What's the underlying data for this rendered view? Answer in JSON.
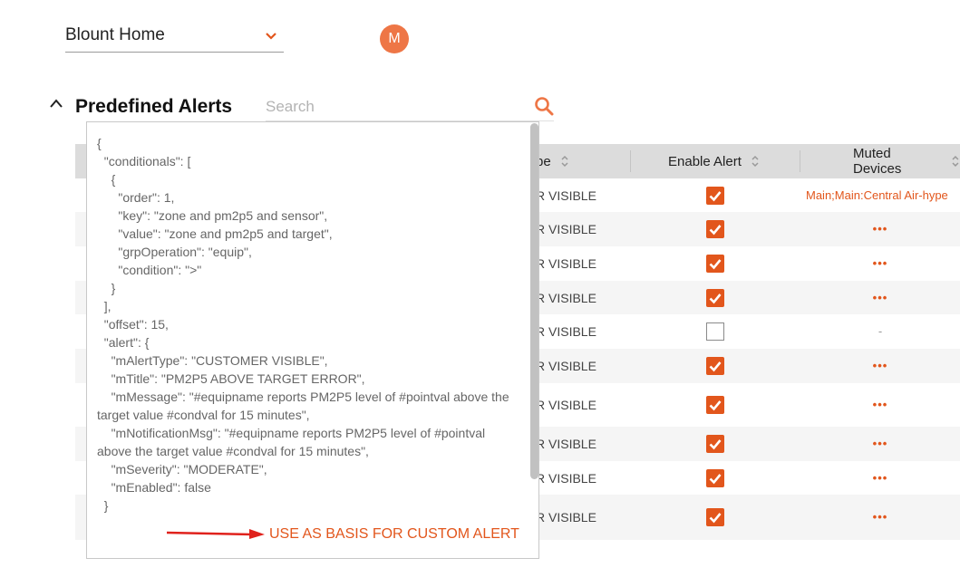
{
  "header": {
    "site_name": "Blount Home",
    "avatar_initial": "M"
  },
  "section": {
    "title": "Predefined Alerts",
    "search_placeholder": "Search"
  },
  "table": {
    "columns": [
      {
        "label": "pe"
      },
      {
        "label": "Enable Alert"
      },
      {
        "label": "Muted Devices"
      }
    ],
    "rows": [
      {
        "type": "R VISIBLE",
        "enabled": true,
        "muted": "Main;Main:Central Air-hype"
      },
      {
        "type": "R VISIBLE",
        "enabled": true,
        "muted": "•••"
      },
      {
        "type": "R VISIBLE",
        "enabled": true,
        "muted": "•••"
      },
      {
        "type": "R VISIBLE",
        "enabled": true,
        "muted": "•••"
      },
      {
        "type": "R VISIBLE",
        "enabled": false,
        "muted": "-"
      },
      {
        "type": "R VISIBLE",
        "enabled": true,
        "muted": "•••"
      },
      {
        "type": "R VISIBLE",
        "enabled": true,
        "muted": "•••"
      },
      {
        "type": "R VISIBLE",
        "enabled": true,
        "muted": "•••"
      },
      {
        "type": "R VISIBLE",
        "enabled": true,
        "muted": "•••"
      },
      {
        "type": "R VISIBLE",
        "enabled": true,
        "muted": "•••"
      }
    ]
  },
  "popup": {
    "json_text": "{\n  \"conditionals\": [\n    {\n      \"order\": 1,\n      \"key\": \"zone and pm2p5 and sensor\",\n      \"value\": \"zone and pm2p5 and target\",\n      \"grpOperation\": \"equip\",\n      \"condition\": \">\"\n    }\n  ],\n  \"offset\": 15,\n  \"alert\": {\n    \"mAlertType\": \"CUSTOMER VISIBLE\",\n    \"mTitle\": \"PM2P5 ABOVE TARGET ERROR\",\n    \"mMessage\": \"#equipname reports PM2P5 level of #pointval above the target value #condval for 15 minutes\",\n    \"mNotificationMsg\": \"#equipname reports PM2P5 level of #pointval above the target value #condval for 15 minutes\",\n    \"mSeverity\": \"MODERATE\",\n    \"mEnabled\": false\n  }",
    "action_label": "USE AS BASIS FOR CUSTOM ALERT"
  },
  "colors": {
    "accent": "#e2561c",
    "avatar": "#ee7646",
    "header_bg": "#dcdcdc"
  }
}
